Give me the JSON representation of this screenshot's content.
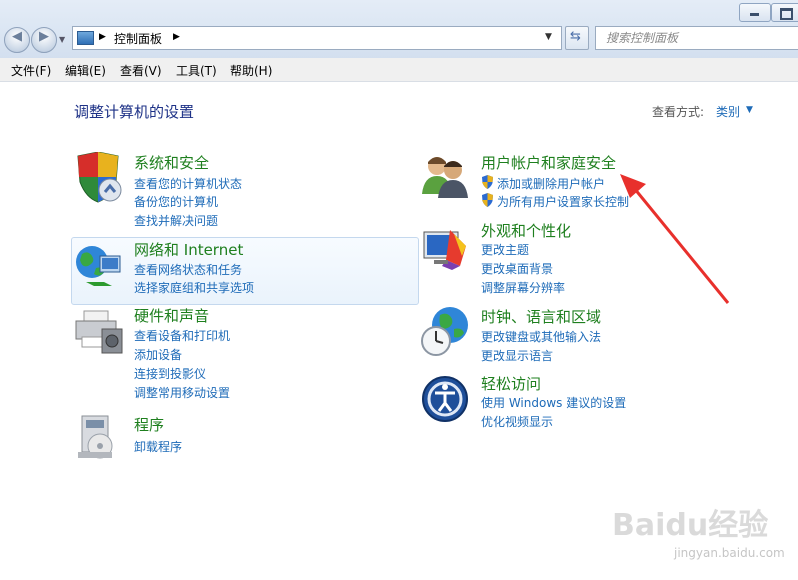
{
  "window": {
    "minimize_label": "",
    "maximize_label": ""
  },
  "address": {
    "crumbs": [
      "控制面板"
    ],
    "search_placeholder": "搜索控制面板"
  },
  "menu": [
    "文件(F)",
    "编辑(E)",
    "查看(V)",
    "工具(T)",
    "帮助(H)"
  ],
  "page": {
    "title": "调整计算机的设置",
    "view_by_label": "查看方式:",
    "view_by_value": "类别"
  },
  "categories": [
    {
      "title": "系统和安全",
      "links": [
        "查看您的计算机状态",
        "备份您的计算机",
        "查找并解决问题"
      ],
      "icon": "shield-icon"
    },
    {
      "title": "网络和 Internet",
      "links": [
        "查看网络状态和任务",
        "选择家庭组和共享选项"
      ],
      "icon": "network-icon"
    },
    {
      "title": "硬件和声音",
      "links": [
        "查看设备和打印机",
        "添加设备",
        "连接到投影仪",
        "调整常用移动设置"
      ],
      "icon": "printer-icon"
    },
    {
      "title": "程序",
      "links": [
        "卸载程序"
      ],
      "icon": "programs-icon"
    },
    {
      "title": "用户帐户和家庭安全",
      "links": [
        "添加或删除用户帐户",
        "为所有用户设置家长控制"
      ],
      "icon": "users-icon"
    },
    {
      "title": "外观和个性化",
      "links": [
        "更改主题",
        "更改桌面背景",
        "调整屏幕分辨率"
      ],
      "icon": "appearance-icon"
    },
    {
      "title": "时钟、语言和区域",
      "links": [
        "更改键盘或其他输入法",
        "更改显示语言"
      ],
      "icon": "clock-globe-icon"
    },
    {
      "title": "轻松访问",
      "links": [
        "使用 Windows 建议的设置",
        "优化视频显示"
      ],
      "icon": "ease-of-access-icon"
    }
  ],
  "watermark": {
    "brand": "Baidu经验",
    "url": "jingyan.baidu.com"
  },
  "colors": {
    "category_title": "#1e7f1e",
    "link": "#1e6bb8",
    "annotation_arrow": "#e8302c"
  }
}
